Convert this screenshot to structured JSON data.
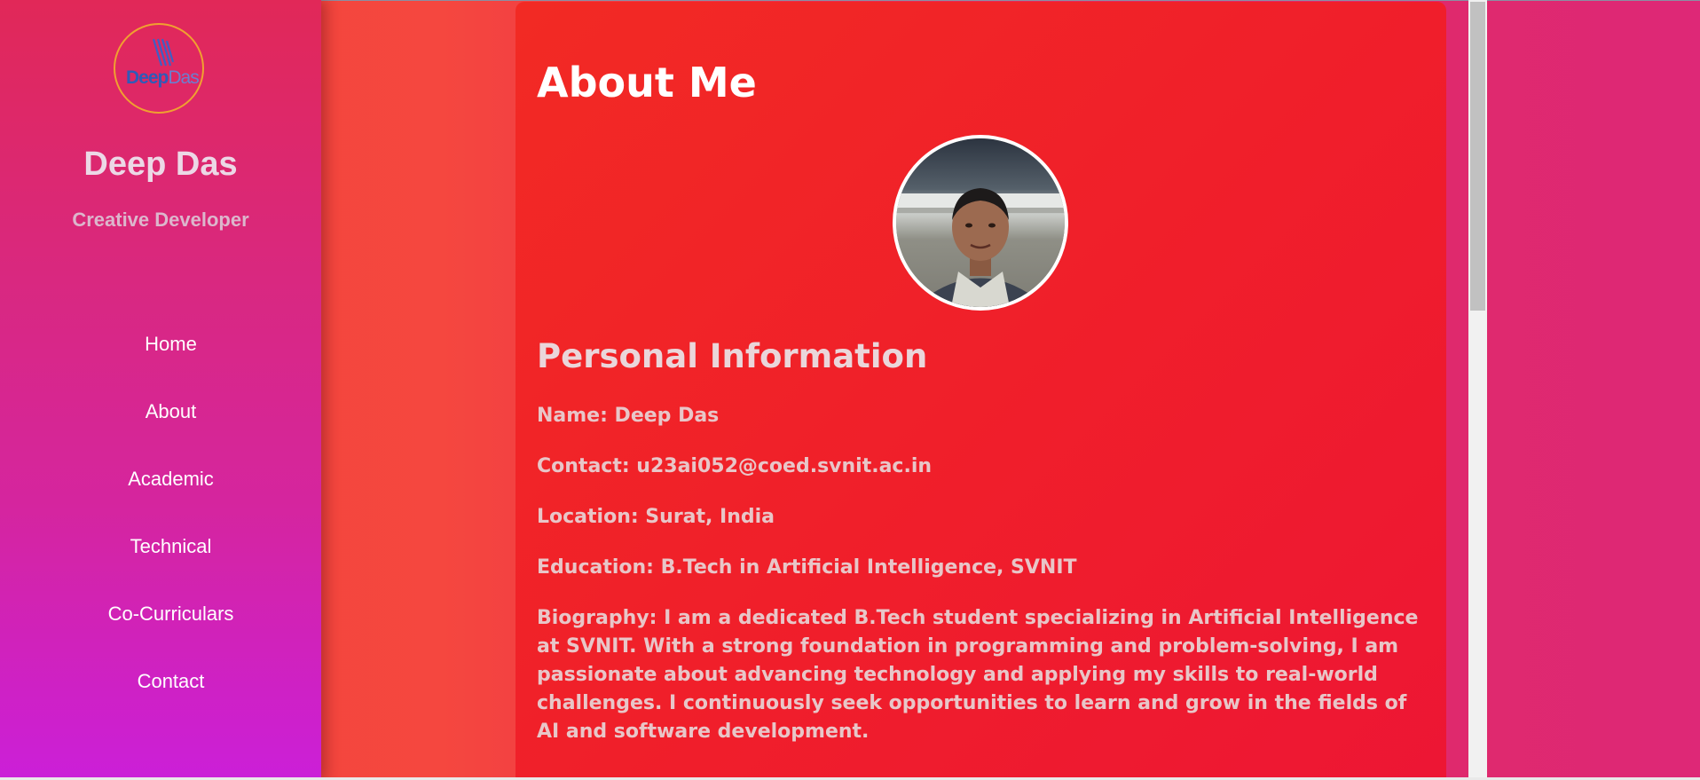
{
  "sidebar": {
    "logo": {
      "part1": "Deep",
      "part2": "Das"
    },
    "name": "Deep Das",
    "role": "Creative Developer",
    "nav": [
      {
        "label": "Home"
      },
      {
        "label": "About"
      },
      {
        "label": "Academic"
      },
      {
        "label": "Technical"
      },
      {
        "label": "Co-Curriculars"
      },
      {
        "label": "Contact"
      }
    ]
  },
  "main": {
    "title": "About Me",
    "section_title": "Personal Information",
    "name_line": "Name: Deep Das",
    "contact_line": "Contact: u23ai052@coed.svnit.ac.in",
    "location_line": "Location: Surat, India",
    "education_line": "Education: B.Tech in Artificial Intelligence, SVNIT",
    "biography_line": "Biography: I am a dedicated B.Tech student specializing in Artificial Intelligence at SVNIT. With a strong foundation in programming and problem-solving, I am passionate about advancing technology and applying my skills to real-world challenges. I continuously seek opportunities to learn and grow in the fields of AI and software development."
  },
  "colors": {
    "sidebar_top": "#e12858",
    "sidebar_bottom": "#cb1fd8",
    "card": "#f01f2a",
    "accent_logo_ring": "#f0a030",
    "logo_text": "#2f5bb8"
  },
  "icons": {
    "avatar": "profile-photo",
    "logo": "deepdas-logo"
  }
}
